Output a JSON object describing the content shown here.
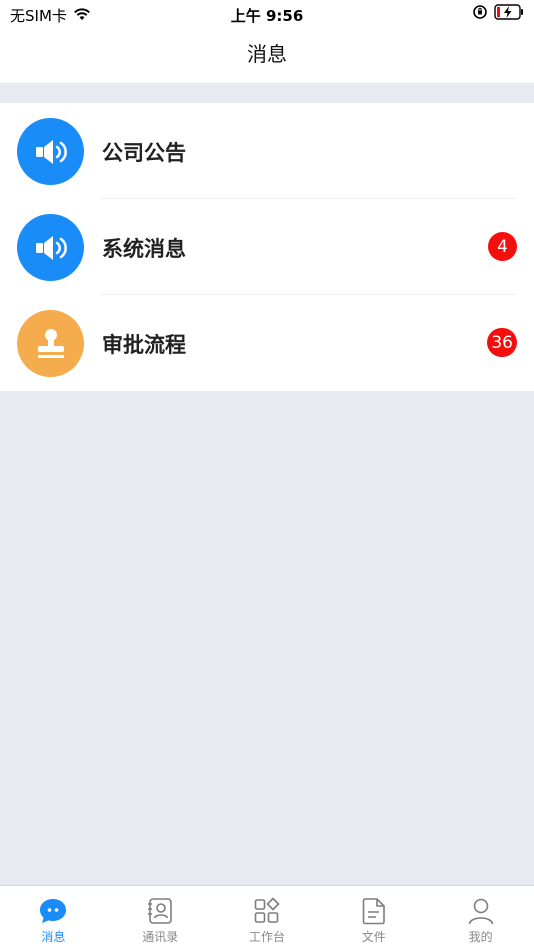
{
  "status_bar": {
    "carrier": "无SIM卡",
    "time": "上午 9:56"
  },
  "header": {
    "title": "消息"
  },
  "messages": [
    {
      "label": "公司公告",
      "icon": "speaker-icon",
      "color": "#1a8cf7",
      "badge": ""
    },
    {
      "label": "系统消息",
      "icon": "speaker-icon",
      "color": "#1a8cf7",
      "badge": "4"
    },
    {
      "label": "审批流程",
      "icon": "stamp-icon",
      "color": "#f5ac4c",
      "badge": "36"
    }
  ],
  "tabs": [
    {
      "label": "消息",
      "icon": "chat-bubble-icon",
      "active": true
    },
    {
      "label": "通讯录",
      "icon": "contacts-icon",
      "active": false
    },
    {
      "label": "工作台",
      "icon": "workbench-icon",
      "active": false
    },
    {
      "label": "文件",
      "icon": "document-icon",
      "active": false
    },
    {
      "label": "我的",
      "icon": "person-icon",
      "active": false
    }
  ],
  "colors": {
    "accent": "#1a8cf7",
    "badge": "#f40f0f",
    "background": "#e9e9f2"
  }
}
